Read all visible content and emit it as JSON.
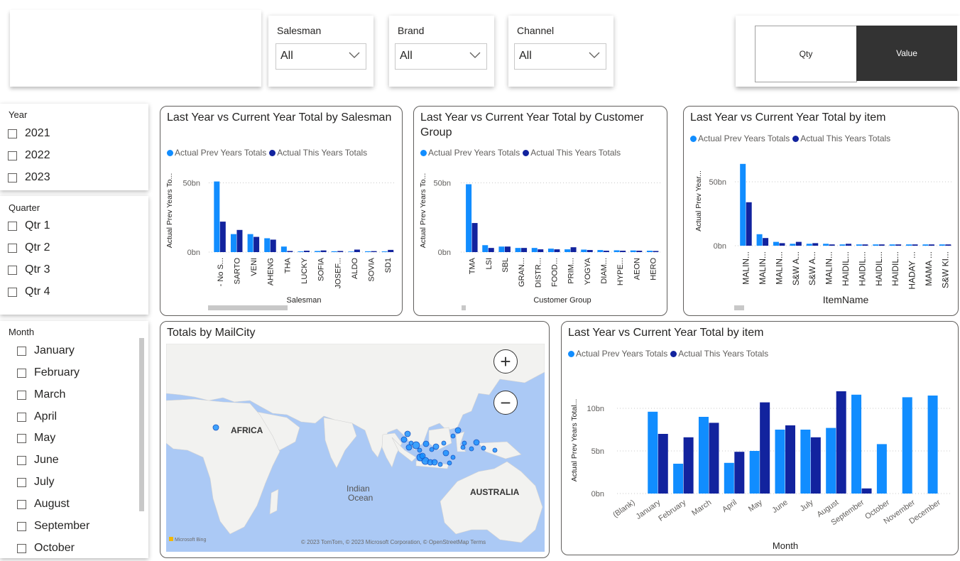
{
  "slicers": {
    "salesman": {
      "label": "Salesman",
      "value": "All"
    },
    "brand": {
      "label": "Brand",
      "value": "All"
    },
    "channel": {
      "label": "Channel",
      "value": "All"
    }
  },
  "toggle": {
    "qty": "Qty",
    "value": "Value",
    "active": "value"
  },
  "filters": {
    "year": {
      "title": "Year",
      "items": [
        "2021",
        "2022",
        "2023"
      ]
    },
    "quarter": {
      "title": "Quarter",
      "items": [
        "Qtr 1",
        "Qtr 2",
        "Qtr 3",
        "Qtr 4"
      ]
    },
    "month": {
      "title": "Month",
      "items": [
        "January",
        "February",
        "March",
        "April",
        "May",
        "June",
        "July",
        "August",
        "September",
        "October"
      ]
    }
  },
  "legend": {
    "prev": "Actual Prev Years Totals",
    "this": "Actual This  Years Totals"
  },
  "colors": {
    "prev": "#118DFF",
    "this": "#12239E",
    "map_water": "#abc9f5",
    "map_land": "#f2f2f0"
  },
  "map": {
    "title": "Totals by MailCity",
    "labels": {
      "africa": "AFRICA",
      "australia": "AUSTRALIA",
      "ocean_1": "Indian",
      "ocean_2": "Ocean"
    },
    "attribution": "© 2023 TomTom, © 2023 Microsoft Corporation, © OpenStreetMap  Terms",
    "bing": "Microsoft Bing",
    "zoom_in": "+",
    "zoom_out": "−"
  },
  "chart_data": [
    {
      "type": "bar",
      "title": "Last Year vs Current Year Total by Salesman",
      "xlabel": "Salesman",
      "ylabel": "Actual Prev Years To...",
      "ylim": [
        0,
        60
      ],
      "yticks": [
        "0bn",
        "50bn"
      ],
      "ytick_values": [
        0,
        50
      ],
      "categories": [
        "- No S...",
        "SARTO",
        "VENI",
        "AHENG",
        "THA",
        "LUCKY",
        "SOFIA",
        "JOSEF...",
        "ALDO",
        "SOVIA",
        "SD1"
      ],
      "series": [
        {
          "name": "Actual Prev Years Totals",
          "values": [
            51,
            13,
            13,
            10,
            4,
            0.5,
            0.8,
            0.6,
            0.4,
            0.6,
            0.5
          ]
        },
        {
          "name": "Actual This  Years Totals",
          "values": [
            22,
            16,
            11,
            9,
            0.8,
            1.0,
            1.2,
            0.8,
            1.8,
            0.7,
            1.6
          ]
        }
      ]
    },
    {
      "type": "bar",
      "title": "Last Year vs Current Year Total by Customer Group",
      "xlabel": "Customer Group",
      "ylabel": "Actual Prev Years To...",
      "ylim": [
        0,
        60
      ],
      "yticks": [
        "0bn",
        "50bn"
      ],
      "ytick_values": [
        0,
        50
      ],
      "categories": [
        "TMA",
        "LSI",
        "SBL",
        "GRAN...",
        "DISTR...",
        "FOOD...",
        "PRIM...",
        "YOGYA",
        "DIAM...",
        "HYPE...",
        "AEON",
        "HERO"
      ],
      "series": [
        {
          "name": "Actual Prev Years Totals",
          "values": [
            49,
            5,
            4,
            3,
            3,
            2.5,
            2,
            1.8,
            1.5,
            1.3,
            1.2,
            1.0
          ]
        },
        {
          "name": "Actual This  Years Totals",
          "values": [
            21,
            3,
            4,
            3,
            2,
            2,
            3.5,
            1.5,
            1,
            1,
            1,
            0.8
          ]
        }
      ]
    },
    {
      "type": "bar",
      "title": "Last Year vs Current Year Total by item",
      "xlabel": "ItemName",
      "ylabel": "Actual Prev Year...",
      "ylim": [
        0,
        70
      ],
      "yticks": [
        "0bn",
        "50bn"
      ],
      "ytick_values": [
        0,
        50
      ],
      "categories": [
        "MALIN...",
        "MALIN...",
        "MALIN...",
        "S&W A...",
        "S&W A...",
        "MALIN...",
        "HAIDIL...",
        "HAIDIL...",
        "HAIDIL...",
        "HAIDIL...",
        "HADAY ...",
        "MAMA ...",
        "S&W KI..."
      ],
      "series": [
        {
          "name": "Actual Prev Years Totals",
          "values": [
            64,
            9,
            3,
            1.5,
            1.5,
            1.5,
            1,
            1,
            1,
            1,
            1,
            1,
            1
          ]
        },
        {
          "name": "Actual This  Years Totals",
          "values": [
            34,
            6,
            2,
            3,
            2,
            1,
            1.5,
            1,
            1,
            1,
            1,
            1,
            1
          ]
        }
      ]
    },
    {
      "type": "bar",
      "title": "Last Year vs Current Year Total by item",
      "xlabel": "Month",
      "ylabel": "Actual Prev Years Total...",
      "ylim": [
        0,
        12.5
      ],
      "yticks": [
        "0bn",
        "5bn",
        "10bn"
      ],
      "ytick_values": [
        0,
        5,
        10
      ],
      "categories": [
        "(Blank)",
        "January",
        "February",
        "March",
        "April",
        "May",
        "June",
        "July",
        "August",
        "September",
        "October",
        "November",
        "December"
      ],
      "series": [
        {
          "name": "Actual Prev Years Totals",
          "values": [
            0,
            9.6,
            3.5,
            9.0,
            3.6,
            5.0,
            7.5,
            7.5,
            7.7,
            11.6,
            5.8,
            11.3,
            11.5
          ]
        },
        {
          "name": "Actual This  Years Totals",
          "values": [
            0,
            7.0,
            6.6,
            8.3,
            4.9,
            10.7,
            8.0,
            6.6,
            12.0,
            0.6,
            0,
            0,
            0
          ]
        }
      ]
    }
  ]
}
